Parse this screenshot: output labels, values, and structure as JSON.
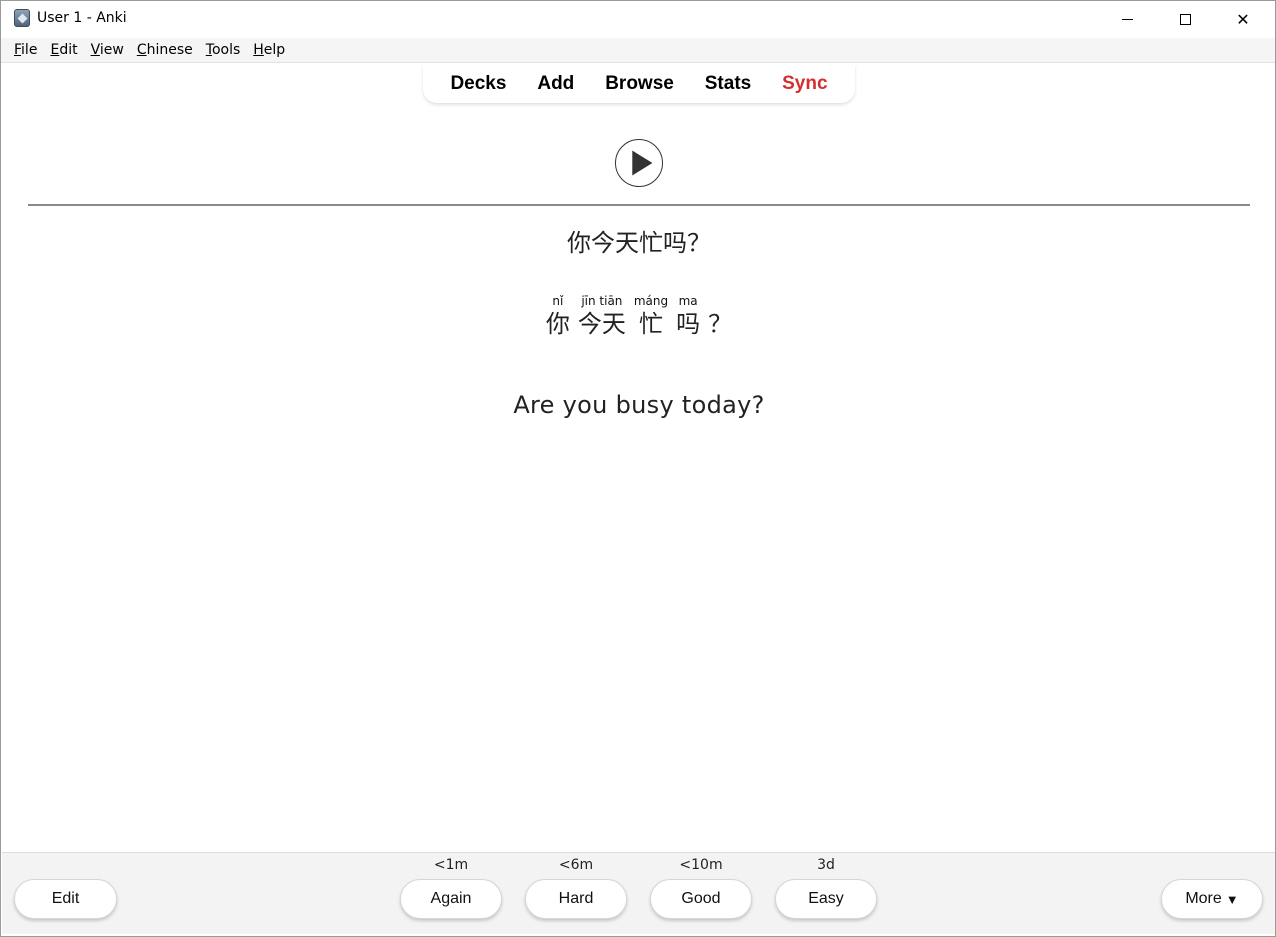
{
  "window": {
    "title": "User 1 - Anki",
    "icon": "anki-app-icon",
    "controls": [
      "minimize-icon",
      "maximize-icon",
      "close-icon"
    ],
    "close_glyph": "✕"
  },
  "menubar": {
    "items": [
      {
        "accel": "F",
        "rest": "ile"
      },
      {
        "accel": "E",
        "rest": "dit"
      },
      {
        "accel": "V",
        "rest": "iew"
      },
      {
        "accel": "C",
        "rest": "hinese"
      },
      {
        "accel": "T",
        "rest": "ools"
      },
      {
        "accel": "H",
        "rest": "elp"
      }
    ]
  },
  "toolbar": {
    "decks": "Decks",
    "add": "Add",
    "browse": "Browse",
    "stats": "Stats",
    "sync": "Sync",
    "sync_color": "#d32f2f"
  },
  "card": {
    "play_icon": "play-icon",
    "sentence": "你今天忙吗？",
    "ruby": [
      {
        "py": "nǐ",
        "hz": "你"
      },
      {
        "py": "jīn tiān",
        "hz": "今天"
      },
      {
        "py": "máng",
        "hz": "忙"
      },
      {
        "py": "ma",
        "hz": "吗"
      },
      {
        "py": "",
        "hz": "？"
      }
    ],
    "translation": "Are you busy today?"
  },
  "bottombar": {
    "edit": "Edit",
    "more": "More",
    "more_arrow": "▼",
    "answers": [
      {
        "interval": "<1m",
        "label": "Again"
      },
      {
        "interval": "<6m",
        "label": "Hard"
      },
      {
        "interval": "<10m",
        "label": "Good"
      },
      {
        "interval": "3d",
        "label": "Easy"
      }
    ]
  }
}
